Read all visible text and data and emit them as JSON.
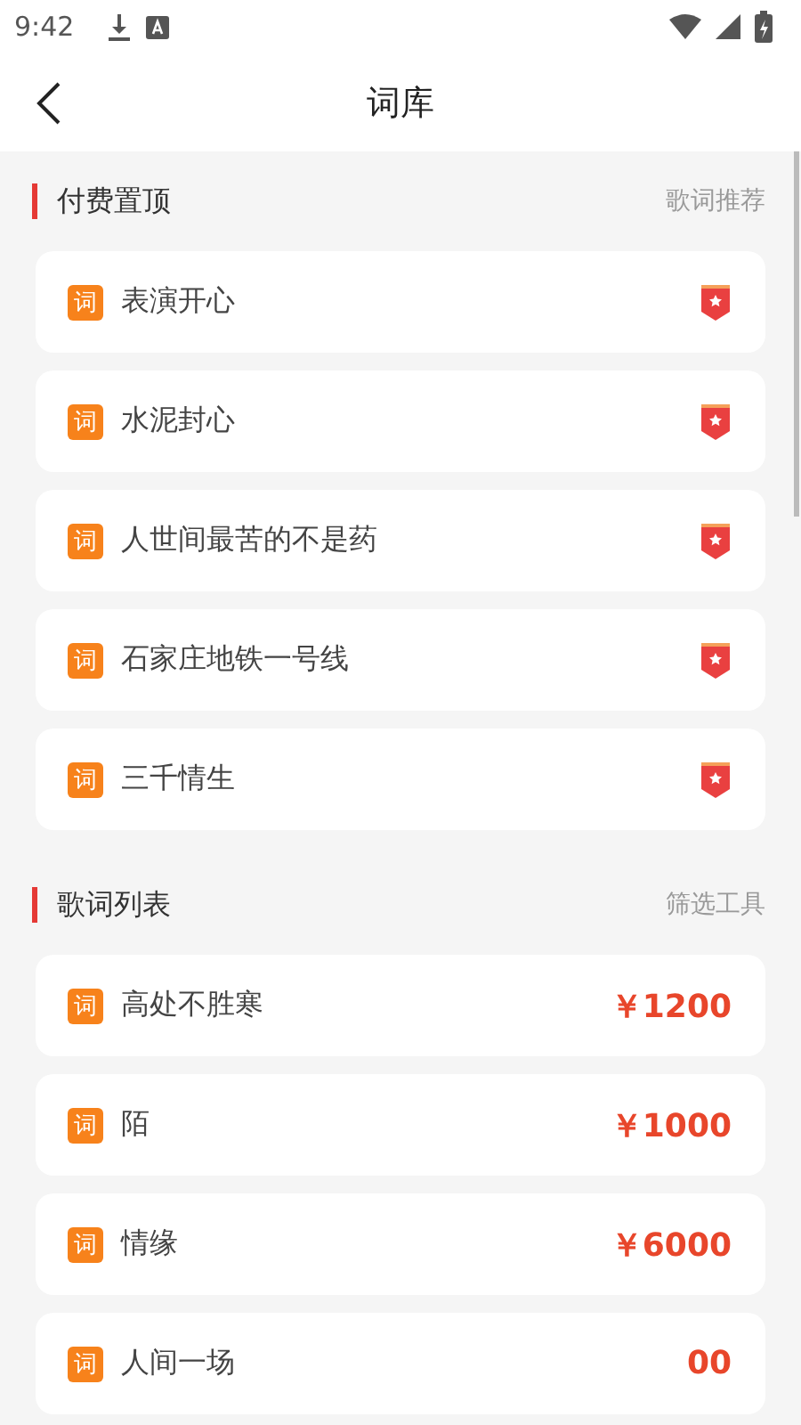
{
  "status_bar": {
    "time": "9:42"
  },
  "header": {
    "title": "词库"
  },
  "sections": [
    {
      "title": "付费置顶",
      "action": "歌词推荐",
      "items": [
        {
          "tag": "词",
          "name": "表演开心",
          "kind": "pinned"
        },
        {
          "tag": "词",
          "name": "水泥封心",
          "kind": "pinned"
        },
        {
          "tag": "词",
          "name": "人世间最苦的不是药",
          "kind": "pinned"
        },
        {
          "tag": "词",
          "name": "石家庄地铁一号线",
          "kind": "pinned"
        },
        {
          "tag": "词",
          "name": "三千情生",
          "kind": "pinned"
        }
      ]
    },
    {
      "title": "歌词列表",
      "action": "筛选工具",
      "items": [
        {
          "tag": "词",
          "name": "高处不胜寒",
          "kind": "price",
          "price": "￥1200"
        },
        {
          "tag": "词",
          "name": "陌",
          "kind": "price",
          "price": "￥1000"
        },
        {
          "tag": "词",
          "name": "情缘",
          "kind": "price",
          "price": "￥6000"
        },
        {
          "tag": "词",
          "name": "人间一场",
          "kind": "price",
          "price": "00"
        }
      ]
    }
  ]
}
